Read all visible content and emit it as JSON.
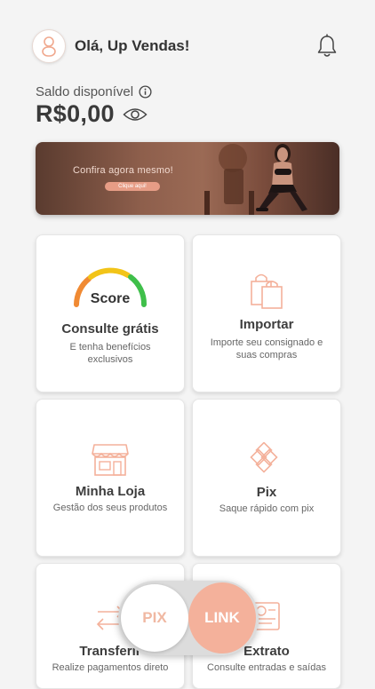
{
  "header": {
    "greeting": "Olá, Up Vendas!",
    "avatar_icon": "user-icon",
    "notification_icon": "bell-icon"
  },
  "balance": {
    "label": "Saldo disponível",
    "value": "R$0,00",
    "info_icon": "info-icon",
    "visibility_icon": "eye-icon"
  },
  "banner": {
    "text": "Confira agora mesmo!",
    "button_label": "Clique aqui!"
  },
  "cards": [
    {
      "gauge_label": "Score",
      "title": "Consulte grátis",
      "subtitle": "E tenha benefícios exclusivos"
    },
    {
      "title": "Importar",
      "subtitle": "Importe seu consignado e suas compras",
      "icon": "shopping-bags-icon"
    },
    {
      "title": "Minha Loja",
      "subtitle": "Gestão dos seus produtos",
      "icon": "store-icon"
    },
    {
      "title": "Pix",
      "subtitle": "Saque rápido com pix",
      "icon": "pix-icon"
    },
    {
      "title": "Transferir",
      "subtitle": "Realize pagamentos direto",
      "icon": "transfer-icon"
    },
    {
      "title": "Extrato",
      "subtitle": "Consulte entradas e saídas",
      "icon": "statement-icon"
    }
  ],
  "fab": {
    "pix_label": "PIX",
    "link_label": "LINK"
  },
  "colors": {
    "accent": "#f4b19b",
    "background": "#f4f4f4",
    "card": "#ffffff"
  }
}
